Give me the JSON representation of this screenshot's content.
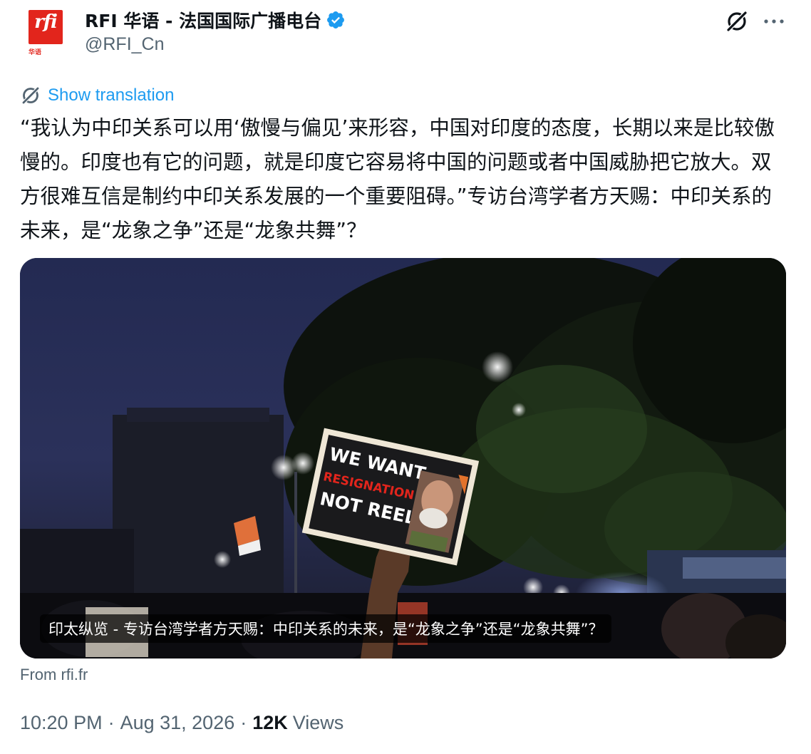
{
  "author": {
    "avatar_logo": "rfi",
    "avatar_sub": "华语",
    "display_name": "RFI 华语 - 法国国际广播电台",
    "handle": "@RFI_Cn",
    "verified": true
  },
  "actions": {
    "grok_icon": "grok-icon",
    "more_icon": "more-dots-icon"
  },
  "translate": {
    "label": "Show translation",
    "icon": "translate-icon"
  },
  "tweet": {
    "text": "“我认为中印关系可以用‘傲慢与偏见’来形容，中国对印度的态度，长期以来是比较傲慢的。印度也有它的问题，就是印度它容易将中国的问题或者中国威胁把它放大。双方很难互信是制约中印关系发展的一个重要阻碍。”专访台湾学者方天赐：中印关系的未来，是“龙象之争”还是“龙象共舞”？"
  },
  "media": {
    "sign_line1": "WE WANT",
    "sign_line2": "RESIGNATION",
    "sign_line3": "NOT REEL",
    "caption": "印太纵览 - 专访台湾学者方天赐：中印关系的未来，是“龙象之争”还是“龙象共舞”？"
  },
  "source": {
    "label": "From rfi.fr"
  },
  "meta": {
    "time": "10:20 PM",
    "separator": "·",
    "date": "Aug 31, 2026",
    "views_count": "12K",
    "views_label": "Views"
  },
  "colors": {
    "link_blue": "#1d9bf0",
    "secondary_text": "#536471",
    "primary_text": "#0f1419",
    "rfi_red": "#e2251c"
  }
}
